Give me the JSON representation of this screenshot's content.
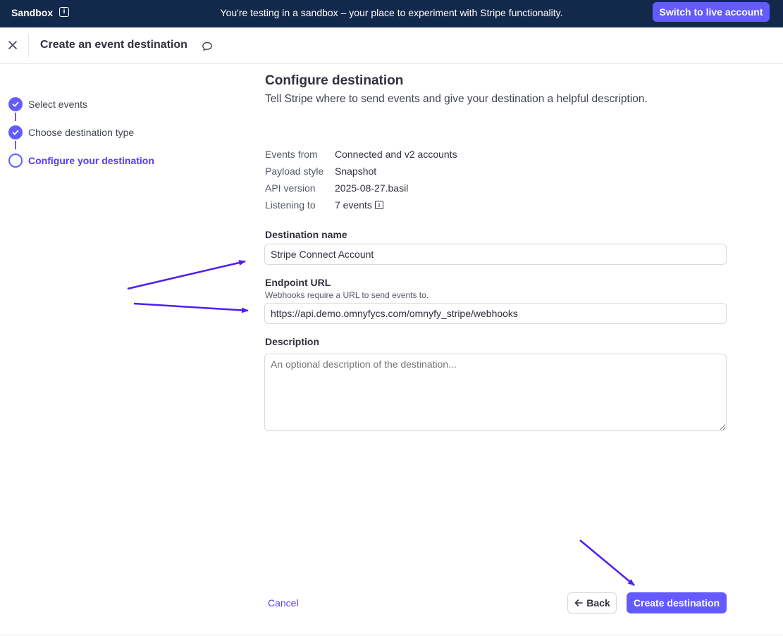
{
  "banner": {
    "label": "Sandbox",
    "message": "You're testing in a sandbox – your place to experiment with Stripe functionality.",
    "live_button": "Switch to live account"
  },
  "header": {
    "title": "Create an event destination"
  },
  "steps": [
    {
      "label": "Select events",
      "state": "complete"
    },
    {
      "label": "Choose destination type",
      "state": "complete"
    },
    {
      "label": "Configure your destination",
      "state": "current"
    }
  ],
  "main": {
    "heading": "Configure destination",
    "subheading": "Tell Stripe where to send events and give your destination a helpful description.",
    "details": [
      {
        "key": "Events from",
        "value": "Connected and v2 accounts"
      },
      {
        "key": "Payload style",
        "value": "Snapshot"
      },
      {
        "key": "API version",
        "value": "2025-08-27.basil"
      },
      {
        "key": "Listening to",
        "value": "7 events"
      }
    ],
    "destination_name": {
      "label": "Destination name",
      "value": "Stripe Connect Account"
    },
    "endpoint_url": {
      "label": "Endpoint URL",
      "hint": "Webhooks require a URL to send events to.",
      "value": "https://api.demo.omnyfycs.com/omnyfy_stripe/webhooks"
    },
    "description": {
      "label": "Description",
      "placeholder": "An optional description of the destination..."
    }
  },
  "footer": {
    "cancel": "Cancel",
    "back": "Back",
    "create": "Create destination"
  },
  "colors": {
    "accent": "#635bff",
    "banner_bg": "#13294b",
    "annotation_arrow": "#4f1df0"
  },
  "icons": [
    "info-icon",
    "close-icon",
    "comment-icon",
    "check-icon",
    "arrow-left-icon"
  ]
}
